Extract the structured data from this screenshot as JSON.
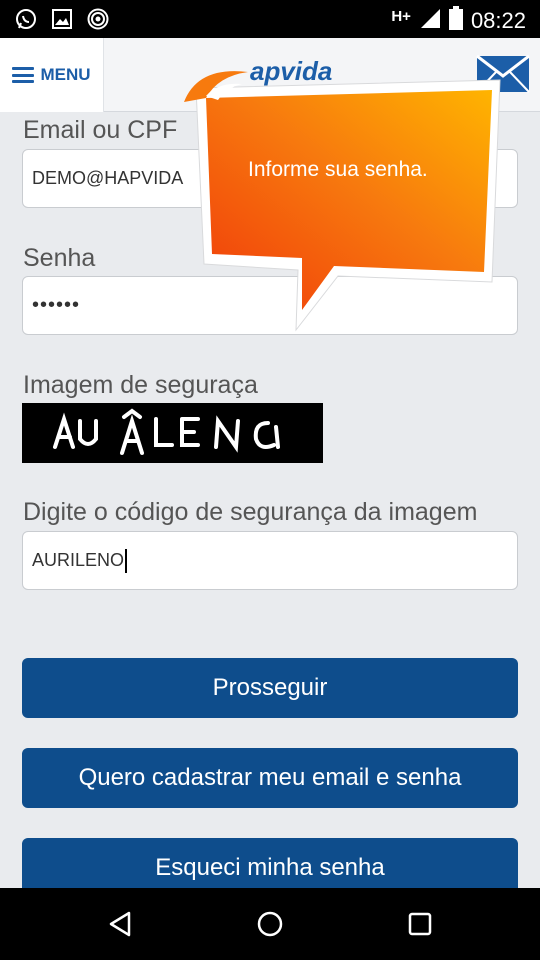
{
  "status_bar": {
    "icons_left": [
      "whatsapp-icon",
      "image-icon",
      "hotspot-icon"
    ],
    "network": "H+",
    "time": "08:22"
  },
  "header": {
    "menu_label": "MENU",
    "logo_text": "apvida"
  },
  "form": {
    "email_label": "Email ou CPF",
    "email_value": "DEMO@HAPVIDA",
    "password_label": "Senha",
    "password_value": "••••••",
    "captcha_label": "Imagem de seguraça",
    "captcha_text": "AU ÂLE NO",
    "code_label": "Digite o código de segurança da imagem",
    "code_value": "AURILENO"
  },
  "buttons": {
    "proceed": "Prosseguir",
    "register": "Quero cadastrar meu email e senha",
    "forgot": "Esqueci minha senha"
  },
  "tooltip": {
    "text": "Informe sua senha."
  },
  "colors": {
    "primary": "#0e4d8c",
    "accent_orange": "#f47a12",
    "accent_yellow": "#ffb000"
  }
}
